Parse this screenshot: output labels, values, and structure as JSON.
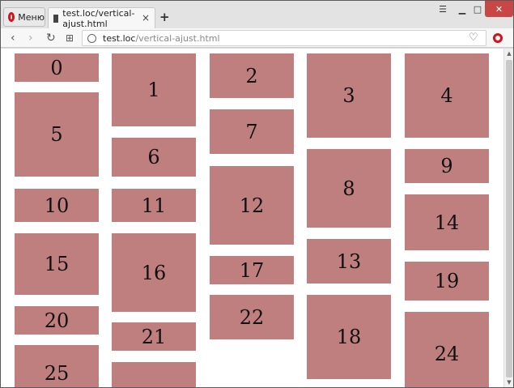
{
  "browser": {
    "menu_label": "Меню",
    "tab_title": "test.loc/vertical-ajust.html",
    "url_host": "test.loc",
    "url_path": "/vertical-ajust.html"
  },
  "boxes": [
    "0",
    "1",
    "2",
    "3",
    "4",
    "5",
    "6",
    "7",
    "8",
    "9",
    "10",
    "11",
    "12",
    "13",
    "14",
    "15",
    "16",
    "17",
    "18",
    "19",
    "20",
    "21",
    "22",
    "24",
    "25"
  ]
}
